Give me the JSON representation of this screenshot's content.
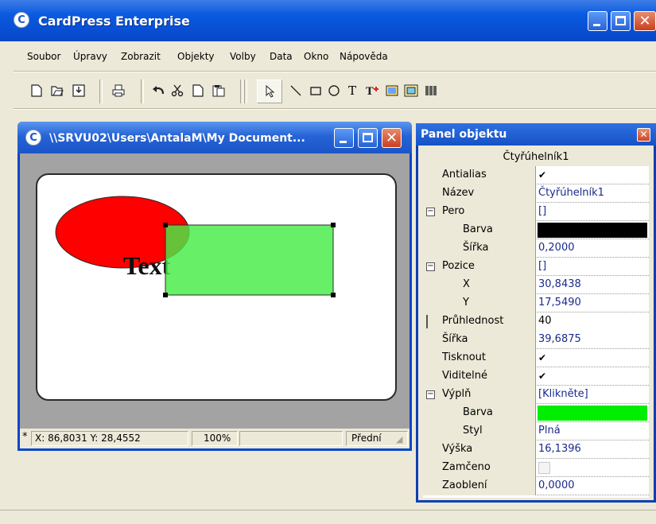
{
  "app": {
    "title": "CardPress Enterprise"
  },
  "menu": [
    "Soubor",
    "Úpravy",
    "Zobrazit",
    "Objekty",
    "Volby",
    "Data",
    "Okno",
    "Nápověda"
  ],
  "toolbar": {
    "icons": [
      "new-document-icon",
      "open-icon",
      "save-icon",
      "print-icon",
      "undo-icon",
      "cut-icon",
      "copy-icon",
      "paste-icon",
      "select-pointer-icon",
      "line-tool-icon",
      "rectangle-tool-icon",
      "ellipse-tool-icon",
      "text-tool-icon",
      "text-field-tool-icon",
      "image-tool-icon",
      "picture-frame-tool-icon",
      "barcode-tool-icon"
    ]
  },
  "document": {
    "title": "\\\\SRVU02\\Users\\AntalaM\\My Document...",
    "canvas": {
      "text": "Text"
    },
    "colors": {
      "ellipse": "#ff0000",
      "rectangle": "#66f266",
      "card": "#ffffff",
      "workspace": "#a3a3a3"
    },
    "status": {
      "modified": "*",
      "coords": "X: 86,8031 Y: 28,4552",
      "zoom": "100%",
      "side": "Přední"
    }
  },
  "panel": {
    "title": "Panel objektu",
    "object_name": "Čtyřúhelník1",
    "rows": [
      {
        "name": "Antialias",
        "value": "✔",
        "kind": "check"
      },
      {
        "name": "Název",
        "value": "Čtyřúhelník1"
      },
      {
        "name": "Pero",
        "value": "[]",
        "expander": "⊟"
      },
      {
        "name": "Barva",
        "value": "",
        "kind": "color",
        "color": "#000000",
        "indent": true
      },
      {
        "name": "Šířka",
        "value": "0,2000",
        "indent": true
      },
      {
        "name": "Pozice",
        "value": "[]",
        "expander": "⊟"
      },
      {
        "name": "X",
        "value": "30,8438",
        "indent": true
      },
      {
        "name": "Y",
        "value": "17,5490",
        "indent": true
      },
      {
        "name": "Průhlednost",
        "value": "40",
        "kind": "edit"
      },
      {
        "name": "Šířka",
        "value": "39,6875"
      },
      {
        "name": "Tisknout",
        "value": "✔",
        "kind": "check"
      },
      {
        "name": "Viditelné",
        "value": "✔",
        "kind": "check"
      },
      {
        "name": "Výplň",
        "value": "[Klikněte]",
        "expander": "⊟"
      },
      {
        "name": "Barva",
        "value": "",
        "kind": "color",
        "color": "#00ee00",
        "indent": true
      },
      {
        "name": "Styl",
        "value": "Plná",
        "indent": true
      },
      {
        "name": "Výška",
        "value": "16,1396"
      },
      {
        "name": "Zamčeno",
        "value": "",
        "kind": "checkbox-disabled"
      },
      {
        "name": "Zaoblení",
        "value": "0,0000"
      }
    ]
  }
}
